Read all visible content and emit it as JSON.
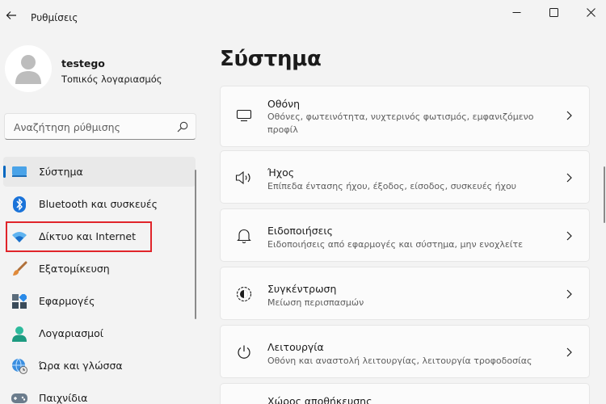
{
  "window": {
    "title": "Ρυθμίσεις"
  },
  "user": {
    "name": "testego",
    "account_type": "Τοπικός λογαριασμός"
  },
  "search": {
    "placeholder": "Αναζήτηση ρύθμισης"
  },
  "sidebar": {
    "items": [
      {
        "label": "Σύστημα",
        "icon": "system-icon",
        "active": true
      },
      {
        "label": "Bluetooth και συσκευές",
        "icon": "bluetooth-icon"
      },
      {
        "label": "Δίκτυο και Internet",
        "icon": "wifi-icon",
        "highlighted": true
      },
      {
        "label": "Εξατομίκευση",
        "icon": "brush-icon"
      },
      {
        "label": "Εφαρμογές",
        "icon": "apps-icon"
      },
      {
        "label": "Λογαριασμοί",
        "icon": "accounts-icon"
      },
      {
        "label": "Ώρα και γλώσσα",
        "icon": "globe-clock-icon"
      },
      {
        "label": "Παιχνίδια",
        "icon": "gamepad-icon"
      }
    ]
  },
  "main": {
    "title": "Σύστημα",
    "cards": [
      {
        "title": "Οθόνη",
        "description": "Οθόνες, φωτεινότητα, νυχτερινός φωτισμός, εμφανιζόμενο προφίλ",
        "icon": "monitor-icon"
      },
      {
        "title": "Ήχος",
        "description": "Επίπεδα έντασης ήχου, έξοδος, είσοδος, συσκευές ήχου",
        "icon": "speaker-icon"
      },
      {
        "title": "Ειδοποιήσεις",
        "description": "Ειδοποιήσεις από εφαρμογές και σύστημα, μην ενοχλείτε",
        "icon": "bell-icon"
      },
      {
        "title": "Συγκέντρωση",
        "description": "Μείωση περισπασμών",
        "icon": "focus-icon"
      },
      {
        "title": "Λειτουργία",
        "description": "Οθόνη και αναστολή λειτουργίας, λειτουργία τροφοδοσίας",
        "icon": "power-icon"
      },
      {
        "title": "Χώρος αποθήκευσης",
        "description": "",
        "icon": "storage-icon"
      }
    ]
  },
  "colors": {
    "accent": "#0067c0",
    "highlight": "#e0242a",
    "background": "#f3f3f3",
    "card": "#fbfbfb"
  }
}
